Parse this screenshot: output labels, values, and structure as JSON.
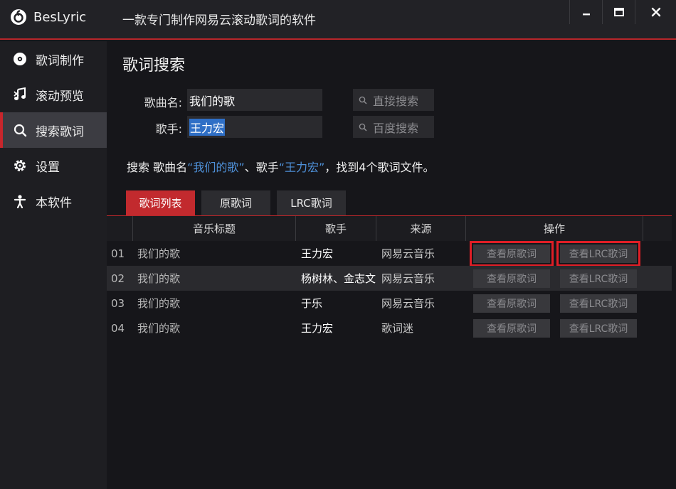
{
  "app": {
    "name": "BesLyric",
    "subtitle": "一款专门制作网易云滚动歌词的软件"
  },
  "window_controls": {
    "minimize": "−",
    "maximize": "□",
    "close": "✕"
  },
  "sidebar": {
    "items": [
      {
        "label": "歌词制作",
        "icon": "disc-icon",
        "active": false
      },
      {
        "label": "滚动预览",
        "icon": "music-note-icon",
        "active": false
      },
      {
        "label": "搜索歌词",
        "icon": "search-icon",
        "active": true
      },
      {
        "label": "设置",
        "icon": "gear-icon",
        "active": false
      },
      {
        "label": "本软件",
        "icon": "figure-icon",
        "active": false
      }
    ]
  },
  "main": {
    "title": "歌词搜索",
    "song_label": "歌曲名:",
    "song_value": "我们的歌",
    "artist_label": "歌手:",
    "artist_value": "王力宏",
    "direct_search": "直接搜索",
    "baidu_search": "百度搜索",
    "result": {
      "prefix": "搜索 歌曲名",
      "song": "“我们的歌”",
      "mid": "、歌手",
      "artist": "“王力宏”",
      "suffix": "，找到4个歌词文件。"
    }
  },
  "tabs": [
    {
      "label": "歌词列表",
      "active": true
    },
    {
      "label": "原歌词",
      "active": false
    },
    {
      "label": "LRC歌词",
      "active": false
    }
  ],
  "table": {
    "headers": [
      "音乐标题",
      "歌手",
      "来源",
      "操作"
    ],
    "rows": [
      {
        "num": "01",
        "title": "我们的歌",
        "artist": "王力宏",
        "source": "网易云音乐",
        "btn1": "查看原歌词",
        "btn2": "查看LRC歌词"
      },
      {
        "num": "02",
        "title": "我们的歌",
        "artist": "杨树林、金志文",
        "source": "网易云音乐",
        "btn1": "查看原歌词",
        "btn2": "查看LRC歌词"
      },
      {
        "num": "03",
        "title": "我们的歌",
        "artist": "于乐",
        "source": "网易云音乐",
        "btn1": "查看原歌词",
        "btn2": "查看LRC歌词"
      },
      {
        "num": "04",
        "title": "我们的歌",
        "artist": "王力宏",
        "source": "歌词迷",
        "btn1": "查看原歌词",
        "btn2": "查看LRC歌词"
      }
    ]
  },
  "colors": {
    "accent": "#c22a2e",
    "highlight": "#e01e26",
    "link": "#4e90d8",
    "background": "#16161a"
  }
}
